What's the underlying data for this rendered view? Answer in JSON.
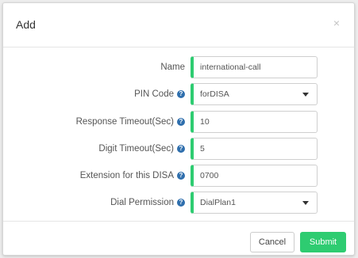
{
  "dialog": {
    "title": "Add",
    "close_glyph": "×"
  },
  "form": {
    "name": {
      "label": "Name",
      "value": "international-call"
    },
    "pin_code": {
      "label": "PIN Code",
      "value": "forDISA",
      "help_icon": "question-circle-icon"
    },
    "response_timeout": {
      "label": "Response Timeout(Sec)",
      "value": "10",
      "help_icon": "question-circle-icon"
    },
    "digit_timeout": {
      "label": "Digit Timeout(Sec)",
      "value": "5",
      "help_icon": "question-circle-icon"
    },
    "extension": {
      "label": "Extension for this DISA",
      "value": "0700",
      "help_icon": "question-circle-icon"
    },
    "dial_permission": {
      "label": "Dial Permission",
      "value": "DialPlan1",
      "help_icon": "question-circle-icon"
    }
  },
  "footer": {
    "cancel_label": "Cancel",
    "submit_label": "Submit"
  },
  "colors": {
    "accent_green": "#2ecc71",
    "help_blue": "#2f6fad"
  }
}
